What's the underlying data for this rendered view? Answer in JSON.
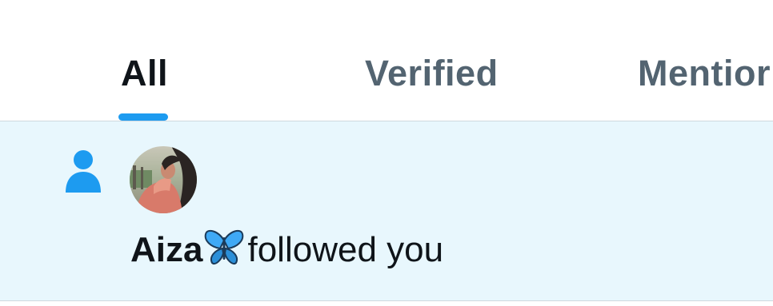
{
  "tabs": [
    {
      "label": "All",
      "selected": true
    },
    {
      "label": "Verified",
      "selected": false
    },
    {
      "label": "Mentior",
      "selected": false
    }
  ],
  "colors": {
    "accent": "#1d9bf0",
    "text_primary": "#0f1419",
    "text_secondary": "#536471",
    "unread_background": "#e8f7fd",
    "divider": "#cfd9de"
  },
  "notification": {
    "type_icon": "person-icon",
    "avatar_icon": "user-avatar",
    "user_name": "Aiza",
    "name_emoji": "butterfly-emoji",
    "action_text": "followed you"
  }
}
